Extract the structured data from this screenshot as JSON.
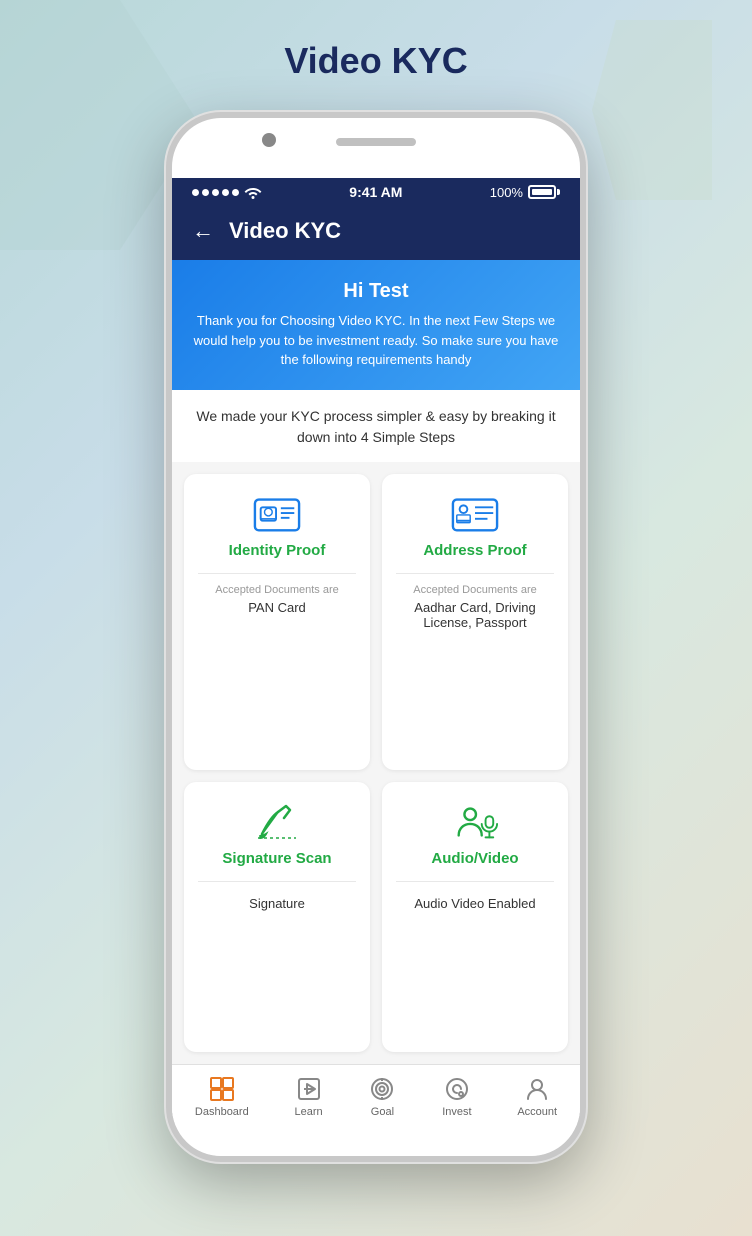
{
  "page": {
    "title": "Video KYC",
    "background": "linear-gradient"
  },
  "status_bar": {
    "signal": "•••••",
    "wifi": "wifi",
    "time": "9:41 AM",
    "battery_pct": "100%"
  },
  "app_header": {
    "back_label": "←",
    "title": "Video KYC"
  },
  "welcome_banner": {
    "greeting": "Hi Test",
    "description": "Thank you for Choosing Video KYC. In the next Few Steps we would help you to be investment ready. So make sure you have the following requirements handy"
  },
  "steps_intro": {
    "text": "We made your KYC process simpler & easy by breaking it down into 4 Simple Steps"
  },
  "cards": [
    {
      "id": "identity-proof",
      "title": "Identity Proof",
      "accepted_label": "Accepted Documents are",
      "documents": "PAN Card",
      "icon": "id-card"
    },
    {
      "id": "address-proof",
      "title": "Address Proof",
      "accepted_label": "Accepted Documents are",
      "documents": "Aadhar Card, Driving License, Passport",
      "icon": "address-card"
    },
    {
      "id": "signature-scan",
      "title": "Signature Scan",
      "accepted_label": "",
      "documents": "Signature",
      "icon": "pen-signature"
    },
    {
      "id": "audio-video",
      "title": "Audio/Video",
      "accepted_label": "",
      "documents": "Audio Video Enabled",
      "icon": "audio-video"
    }
  ],
  "bottom_nav": [
    {
      "id": "dashboard",
      "label": "Dashboard",
      "icon": "dashboard-icon"
    },
    {
      "id": "learn",
      "label": "Learn",
      "icon": "learn-icon"
    },
    {
      "id": "goal",
      "label": "Goal",
      "icon": "goal-icon"
    },
    {
      "id": "invest",
      "label": "Invest",
      "icon": "invest-icon"
    },
    {
      "id": "account",
      "label": "Account",
      "icon": "account-icon"
    }
  ]
}
